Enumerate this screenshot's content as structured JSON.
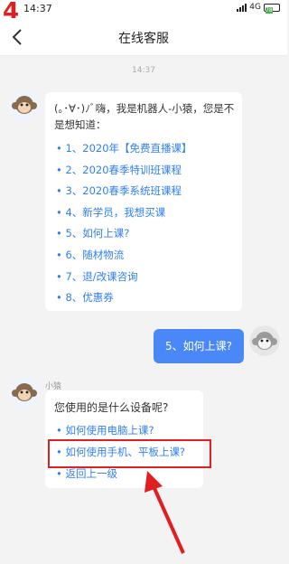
{
  "status_bar": {
    "step_number": "4",
    "time": "14:37",
    "network": "4G",
    "battery": "78"
  },
  "header": {
    "title": "在线客服",
    "back_icon": "chevron-left-icon"
  },
  "chat": {
    "timestamp": "14:37",
    "bot_message": {
      "greeting": "(｡･∀･)ﾉﾞ嗨，我是机器人-小猿，您是不是想知道：",
      "menu": [
        "• 1、2020年【免费直播课】",
        "• 2、2020春季特训班课程",
        "• 3、2020春季系统班课程",
        "• 4、新学员，我想买课",
        "• 5、如何上课?",
        "• 6、随材物流",
        "• 7、退/改课咨询",
        "• 8、优惠券"
      ]
    },
    "user_message": "5、如何上课?",
    "bot_reply": {
      "sender": "小猿",
      "question": "您使用的是什么设备呢?",
      "options": [
        "• 如何使用电脑上课?",
        "• 如何使用手机、平板上课?",
        "• 返回上一级"
      ]
    }
  },
  "colors": {
    "accent": "#4a88f7",
    "link": "#2f7ff5",
    "highlight": "#e02020"
  }
}
